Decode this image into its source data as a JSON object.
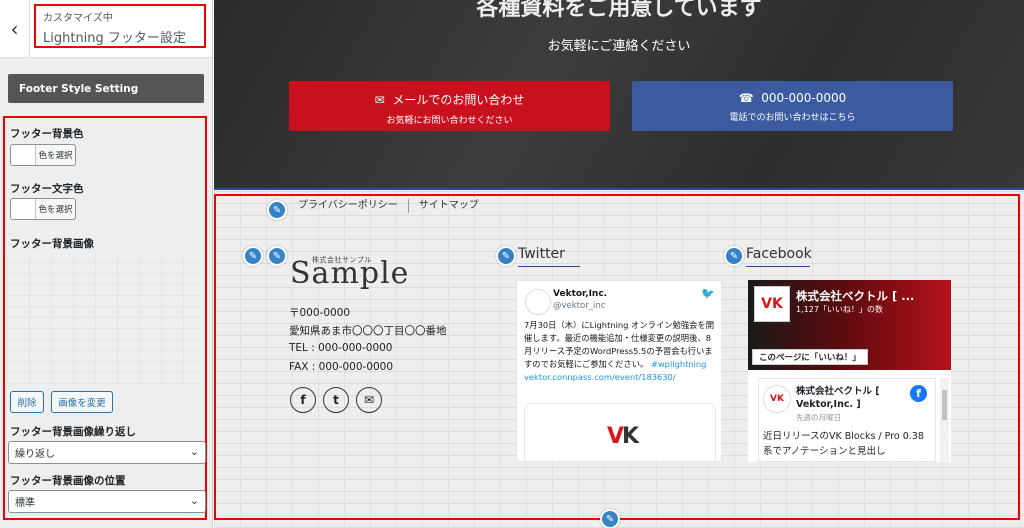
{
  "sidebar": {
    "back_icon": "chevron-left-icon",
    "subtitle": "カスタマイズ中",
    "title": "Lightning フッター設定",
    "section_heading": "Footer Style Setting",
    "bg_color_label": "フッター背景色",
    "text_color_label": "フッター文字色",
    "color_button_label": "色を選択",
    "bg_image_label": "フッター背景画像",
    "remove_button": "削除",
    "change_image_button": "画像を変更",
    "repeat_label": "フッター背景画像繰り返し",
    "repeat_value": "繰り返し",
    "position_label": "フッター背景画像の位置",
    "position_value": "標準"
  },
  "cta": {
    "heading": "各種資料をご用意しています",
    "subheading": "お気軽にご連絡ください",
    "mail_button_title": "メールでのお問い合わせ",
    "mail_button_sub": "お気軽にお問い合わせください",
    "phone_button_title": "000-000-0000",
    "phone_button_sub": "電話でのお問い合わせはこちら",
    "mail_color": "#c8101e",
    "phone_color": "#3c5aa0"
  },
  "footer": {
    "nav": [
      "プライバシーポリシー",
      "サイトマップ"
    ],
    "logo_sub": "株式会社サンプル",
    "logo_main": "Sample",
    "postal": "〒000-0000",
    "address": "愛知県あま市〇〇〇丁目〇〇番地",
    "tel": "TEL : 000-000-0000",
    "fax": "FAX : 000-000-0000",
    "social_icons": [
      "facebook-icon",
      "twitter-icon",
      "mail-icon"
    ]
  },
  "twitter": {
    "widget_title": "Twitter",
    "account_name": "Vektor,Inc.",
    "handle": "@vektor_inc",
    "tweet_text": "7月30日（木）にLightning オンライン勉強会を開催します。最近の機能追加・仕様変更の説明後、8月リリース予定のWordPress5.5の予習会も行いますのでお気軽にご参加ください。",
    "hashtag": "#wplightning",
    "link": "vektor.connpass.com/event/183630/",
    "embed_logo": "VK"
  },
  "facebook": {
    "widget_title": "Facebook",
    "page_name": "株式会社ベクトル [ ...",
    "likes": "1,127「いいね！」の数",
    "like_button": "このページに「いいね！」",
    "post_author": "株式会社ベクトル [ Vektor,Inc. ]",
    "post_time": "先週の月曜日",
    "post_text": "近日リリースのVK Blocks / Pro 0.38 系でアノテーションと見出し",
    "logo_text": "VK"
  },
  "colors": {
    "highlight_border": "#e00000",
    "pencil_button": "#3582c4",
    "accent_line": "#2a4aa0"
  }
}
